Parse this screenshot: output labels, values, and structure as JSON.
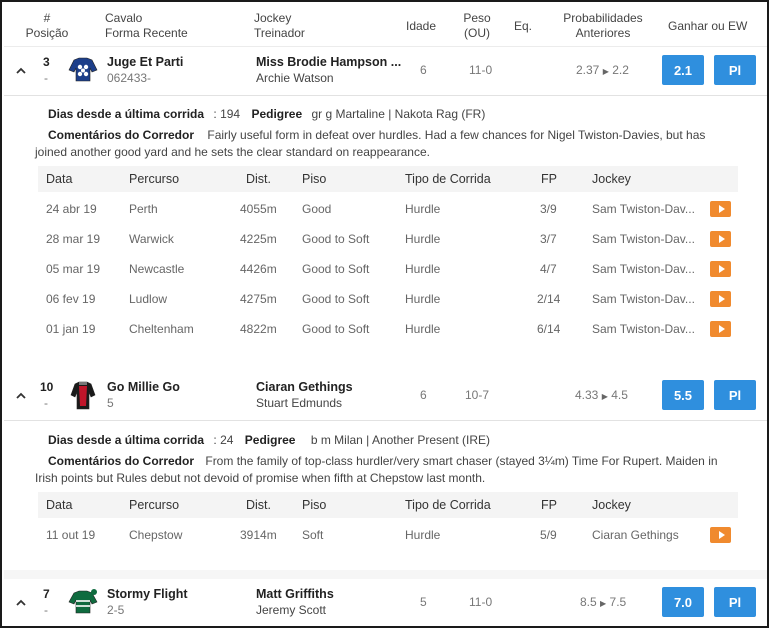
{
  "header": {
    "pos_line1": "#",
    "pos_line2": "Posição",
    "horse_line1": "Cavalo",
    "horse_line2": "Forma Recente",
    "jockey_line1": "Jockey",
    "jockey_line2": "Treinador",
    "age": "Idade",
    "weight_line1": "Peso",
    "weight_line2": "(OU)",
    "eq": "Eq.",
    "odds_line1": "Probabilidades",
    "odds_line2": "Anteriores",
    "bet": "Ganhar ou EW"
  },
  "labels": {
    "days_since": "Dias desde a última corrida",
    "pedigree": "Pedigree",
    "comments": "Comentários do Corredor",
    "col_date": "Data",
    "col_course": "Percurso",
    "col_dist": "Dist.",
    "col_going": "Piso",
    "col_race_type": "Tipo de Corrida",
    "col_fp": "FP",
    "col_jockey": "Jockey",
    "place_button": "Pl"
  },
  "runners": [
    {
      "number": "3",
      "position": "-",
      "horse": "Juge Et Parti",
      "form": "062433-",
      "jockey": "Miss Brodie Hampson ...",
      "trainer": "Archie Watson",
      "age": "6",
      "weight": "11-0",
      "eq": "",
      "odds_prev": "2.37",
      "odds_now": "2.2",
      "win_odds": "2.1",
      "silk_colors": {
        "primary": "#1d3f8a",
        "secondary": "#ffffff"
      },
      "expanded": true,
      "days_since": ": 194",
      "pedigree": "gr g Martaline | Nakota Rag (FR)",
      "comment_a": "Fairly useful form in defeat over hurdles. Had a few chances for Nigel Twiston-Davies, but has",
      "comment_b": "joined another good yard and he sets the clear standard on reappearance.",
      "history": [
        {
          "date": "24 abr 19",
          "course": "Perth",
          "dist": "4055m",
          "going": "Good",
          "type": "Hurdle",
          "fp": "3/9",
          "jockey": "Sam Twiston-Dav..."
        },
        {
          "date": "28 mar 19",
          "course": "Warwick",
          "dist": "4225m",
          "going": "Good to Soft",
          "type": "Hurdle",
          "fp": "3/7",
          "jockey": "Sam Twiston-Dav..."
        },
        {
          "date": "05 mar 19",
          "course": "Newcastle",
          "dist": "4426m",
          "going": "Good to Soft",
          "type": "Hurdle",
          "fp": "4/7",
          "jockey": "Sam Twiston-Dav..."
        },
        {
          "date": "06 fev 19",
          "course": "Ludlow",
          "dist": "4275m",
          "going": "Good to Soft",
          "type": "Hurdle",
          "fp": "2/14",
          "jockey": "Sam Twiston-Dav..."
        },
        {
          "date": "01 jan 19",
          "course": "Cheltenham",
          "dist": "4822m",
          "going": "Good to Soft",
          "type": "Hurdle",
          "fp": "6/14",
          "jockey": "Sam Twiston-Dav..."
        }
      ]
    },
    {
      "number": "10",
      "position": "-",
      "horse": "Go Millie Go",
      "form": "5",
      "jockey": "Ciaran Gethings",
      "trainer": "Stuart Edmunds",
      "age": "6",
      "weight": "10-7",
      "eq": "",
      "odds_prev": "4.33",
      "odds_now": "4.5",
      "win_odds": "5.5",
      "silk_colors": {
        "primary": "#1a1a1a",
        "secondary": "#c0152a"
      },
      "expanded": true,
      "days_since": ": 24",
      "pedigree": "b m Milan | Another Present (IRE)",
      "comment_a": "From the family of top-class hurdler/very smart chaser (stayed 3¼m) Time For Rupert. Maiden in",
      "comment_b": "Irish points but Rules debut not devoid of promise when fifth at Chepstow last month.",
      "history": [
        {
          "date": "11 out 19",
          "course": "Chepstow",
          "dist": "3914m",
          "going": "Soft",
          "type": "Hurdle",
          "fp": "5/9",
          "jockey": "Ciaran Gethings"
        }
      ]
    },
    {
      "number": "7",
      "position": "-",
      "horse": "Stormy Flight",
      "form": "2-5",
      "jockey": "Matt Griffiths",
      "trainer": "Jeremy Scott",
      "age": "5",
      "weight": "11-0",
      "eq": "",
      "odds_prev": "8.5",
      "odds_now": "7.5",
      "win_odds": "7.0",
      "silk_colors": {
        "primary": "#0f6b3f",
        "secondary": "#ffffff"
      },
      "expanded": false
    }
  ],
  "colors": {
    "button_blue": "#2f8fde",
    "video_orange": "#f08a2e"
  }
}
